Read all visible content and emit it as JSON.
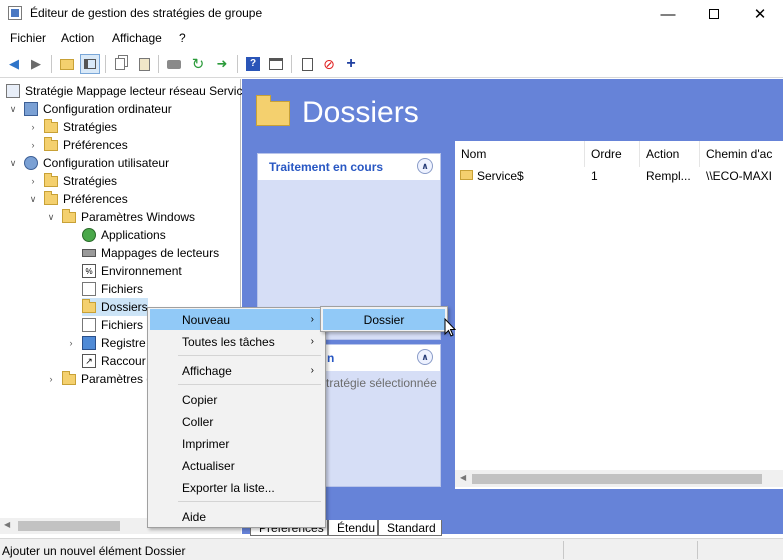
{
  "window": {
    "title": "Éditeur de gestion des stratégies de groupe"
  },
  "menubar": [
    "Fichier",
    "Action",
    "Affichage",
    "?"
  ],
  "tree": {
    "root": "Stratégie Mappage lecteur réseau Service",
    "comp_config": "Configuration ordinateur",
    "comp_strategies": "Stratégies",
    "comp_prefs": "Préférences",
    "user_config": "Configuration utilisateur",
    "user_strategies": "Stratégies",
    "user_prefs": "Préférences",
    "win_params": "Paramètres Windows",
    "applications": "Applications",
    "drive_maps": "Mappages de lecteurs",
    "environment": "Environnement",
    "files": "Fichiers",
    "folders": "Dossiers",
    "ini_files": "Fichiers .",
    "registry": "Registre",
    "shortcuts": "Raccour",
    "panel_params": "Paramètres d"
  },
  "right": {
    "title": "Dossiers",
    "box1_title": "Traitement en cours",
    "box2_title": "n",
    "box2_text": "tratégie sélectionnée"
  },
  "list": {
    "headers": [
      "Nom",
      "Ordre",
      "Action",
      "Chemin d'ac"
    ],
    "rows": [
      {
        "name": "Service$",
        "order": "1",
        "action": "Rempl...",
        "path": "\\\\ECO-MAXI"
      }
    ]
  },
  "tabs": {
    "prefs": "Préférences",
    "extended": "Étendu",
    "standard": "Standard"
  },
  "status": {
    "text": "Ajouter un nouvel élément Dossier"
  },
  "context_menu": {
    "nouveau": "Nouveau",
    "toutes_taches": "Toutes les tâches",
    "affichage": "Affichage",
    "copier": "Copier",
    "coller": "Coller",
    "imprimer": "Imprimer",
    "actualiser": "Actualiser",
    "exporter": "Exporter la liste...",
    "aide": "Aide"
  },
  "submenu": {
    "dossier": "Dossier"
  },
  "colors": {
    "accent_panel": "#6683d8",
    "highlight": "#91c9f7",
    "header_text": "#2857c3"
  }
}
